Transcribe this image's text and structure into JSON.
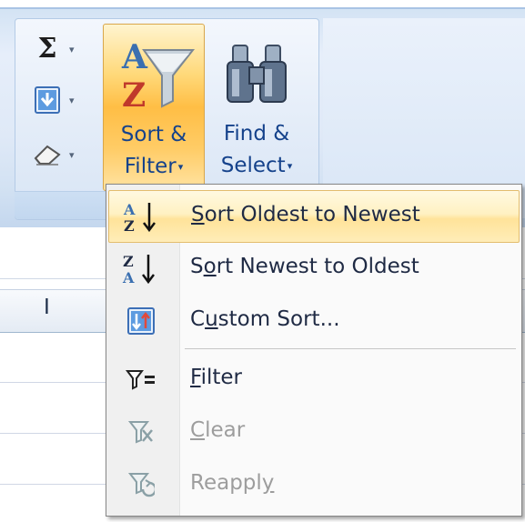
{
  "ribbon": {
    "autosum": {
      "icon": "sigma-icon",
      "glyph": "Σ",
      "arrow": "▾"
    },
    "fill": {
      "icon": "fill-down-icon",
      "arrow": "▾"
    },
    "clear": {
      "icon": "eraser-icon",
      "arrow": "▾"
    },
    "sort_filter": {
      "line1": "Sort &",
      "line2": "Filter",
      "arrow": "▾",
      "icon": "sort-filter-icon"
    },
    "find_select": {
      "line1": "Find &",
      "line2": "Select",
      "arrow": "▾",
      "icon": "binoculars-icon"
    }
  },
  "sheet": {
    "column_header": "I"
  },
  "menu": {
    "items": [
      {
        "label_pre": "",
        "label_key": "S",
        "label_post": "ort Oldest to Newest",
        "icon": "sort-ascending-icon",
        "enabled": true,
        "highlighted": true
      },
      {
        "label_pre": "S",
        "label_key": "o",
        "label_post": "rt Newest to Oldest",
        "icon": "sort-descending-icon",
        "enabled": true,
        "highlighted": false
      },
      {
        "label_pre": "C",
        "label_key": "u",
        "label_post": "stom Sort...",
        "icon": "custom-sort-icon",
        "enabled": true,
        "highlighted": false
      },
      {
        "label_pre": "",
        "label_key": "F",
        "label_post": "ilter",
        "icon": "filter-icon",
        "enabled": true,
        "highlighted": false
      },
      {
        "label_pre": "",
        "label_key": "C",
        "label_post": "lear",
        "icon": "clear-filter-icon",
        "enabled": false,
        "highlighted": false
      },
      {
        "label_pre": "Reappl",
        "label_key": "y",
        "label_post": "",
        "icon": "reapply-icon",
        "enabled": false,
        "highlighted": false
      }
    ]
  },
  "colors": {
    "accent": "#15428b",
    "highlight": "#ffe39a",
    "disabled": "#9d9d9d"
  }
}
